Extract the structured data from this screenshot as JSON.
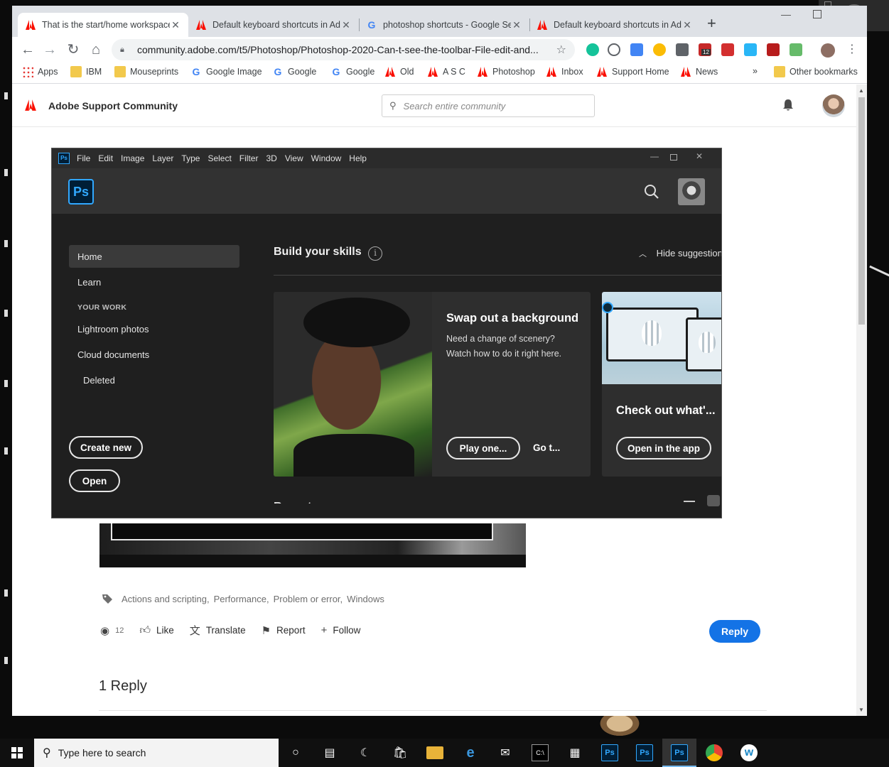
{
  "browser": {
    "tabs": [
      {
        "title": "That is the start/home workspace",
        "icon": "adobe-icon",
        "active": true
      },
      {
        "title": "Default keyboard shortcuts in Ad",
        "icon": "adobe-icon",
        "active": false
      },
      {
        "title": "photoshop shortcuts - Google Se",
        "icon": "google-icon",
        "active": false
      },
      {
        "title": "Default keyboard shortcuts in Ad",
        "icon": "adobe-icon",
        "active": false
      }
    ],
    "url": "community.adobe.com/t5/Photoshop/Photoshop-2020-Can-t-see-the-toolbar-File-edit-and...",
    "extension_badge": "12",
    "bookmarks": [
      {
        "label": "Apps",
        "icon": "apps-grid-icon"
      },
      {
        "label": "IBM",
        "icon": "folder-icon"
      },
      {
        "label": "Mouseprints",
        "icon": "folder-icon"
      },
      {
        "label": "Google Image",
        "icon": "google-icon"
      },
      {
        "label": "Google",
        "icon": "google-icon"
      },
      {
        "label": "Google",
        "icon": "google-icon"
      },
      {
        "label": "Old",
        "icon": "adobe-icon"
      },
      {
        "label": "A S C",
        "icon": "adobe-icon"
      },
      {
        "label": "Photoshop",
        "icon": "adobe-icon"
      },
      {
        "label": "Inbox",
        "icon": "adobe-icon"
      },
      {
        "label": "Support Home",
        "icon": "adobe-icon"
      },
      {
        "label": "News",
        "icon": "adobe-icon"
      }
    ],
    "bookmarks_overflow": "»",
    "other_bookmarks": "Other bookmarks"
  },
  "community": {
    "title": "Adobe Support Community",
    "search_placeholder": "Search entire community",
    "tags": [
      "Actions and scripting,",
      "Performance,",
      "Problem or error,",
      "Windows"
    ],
    "views": "12",
    "actions": {
      "like": "Like",
      "translate": "Translate",
      "report": "Report",
      "follow": "Follow"
    },
    "reply_button": "Reply",
    "replies_count": "1 Reply"
  },
  "photoshop": {
    "menu": [
      "File",
      "Edit",
      "Image",
      "Layer",
      "Type",
      "Select",
      "Filter",
      "3D",
      "View",
      "Window",
      "Help"
    ],
    "logo_text": "Ps",
    "sidebar": {
      "home": "Home",
      "learn": "Learn",
      "your_work_heading": "YOUR WORK",
      "lightroom": "Lightroom photos",
      "cloud": "Cloud documents",
      "deleted": "Deleted",
      "create_new": "Create new",
      "open": "Open"
    },
    "skills_title": "Build your skills",
    "hide_suggestions": "Hide suggestion",
    "card1": {
      "title": "Swap out a background",
      "desc": "Need a change of scenery? Watch how to do it right here.",
      "play": "Play one...",
      "go": "Go t..."
    },
    "card2": {
      "title": "Check out what'...",
      "open_app": "Open in the app"
    },
    "recent_heading": "Recent"
  },
  "taskbar": {
    "search_placeholder": "Type here to search",
    "ps_label": "Ps"
  },
  "colors": {
    "adobe_red": "#fa0f00",
    "ps_blue": "#31a8ff",
    "ps_dark": "#001e36",
    "reply_blue": "#1473e6"
  }
}
